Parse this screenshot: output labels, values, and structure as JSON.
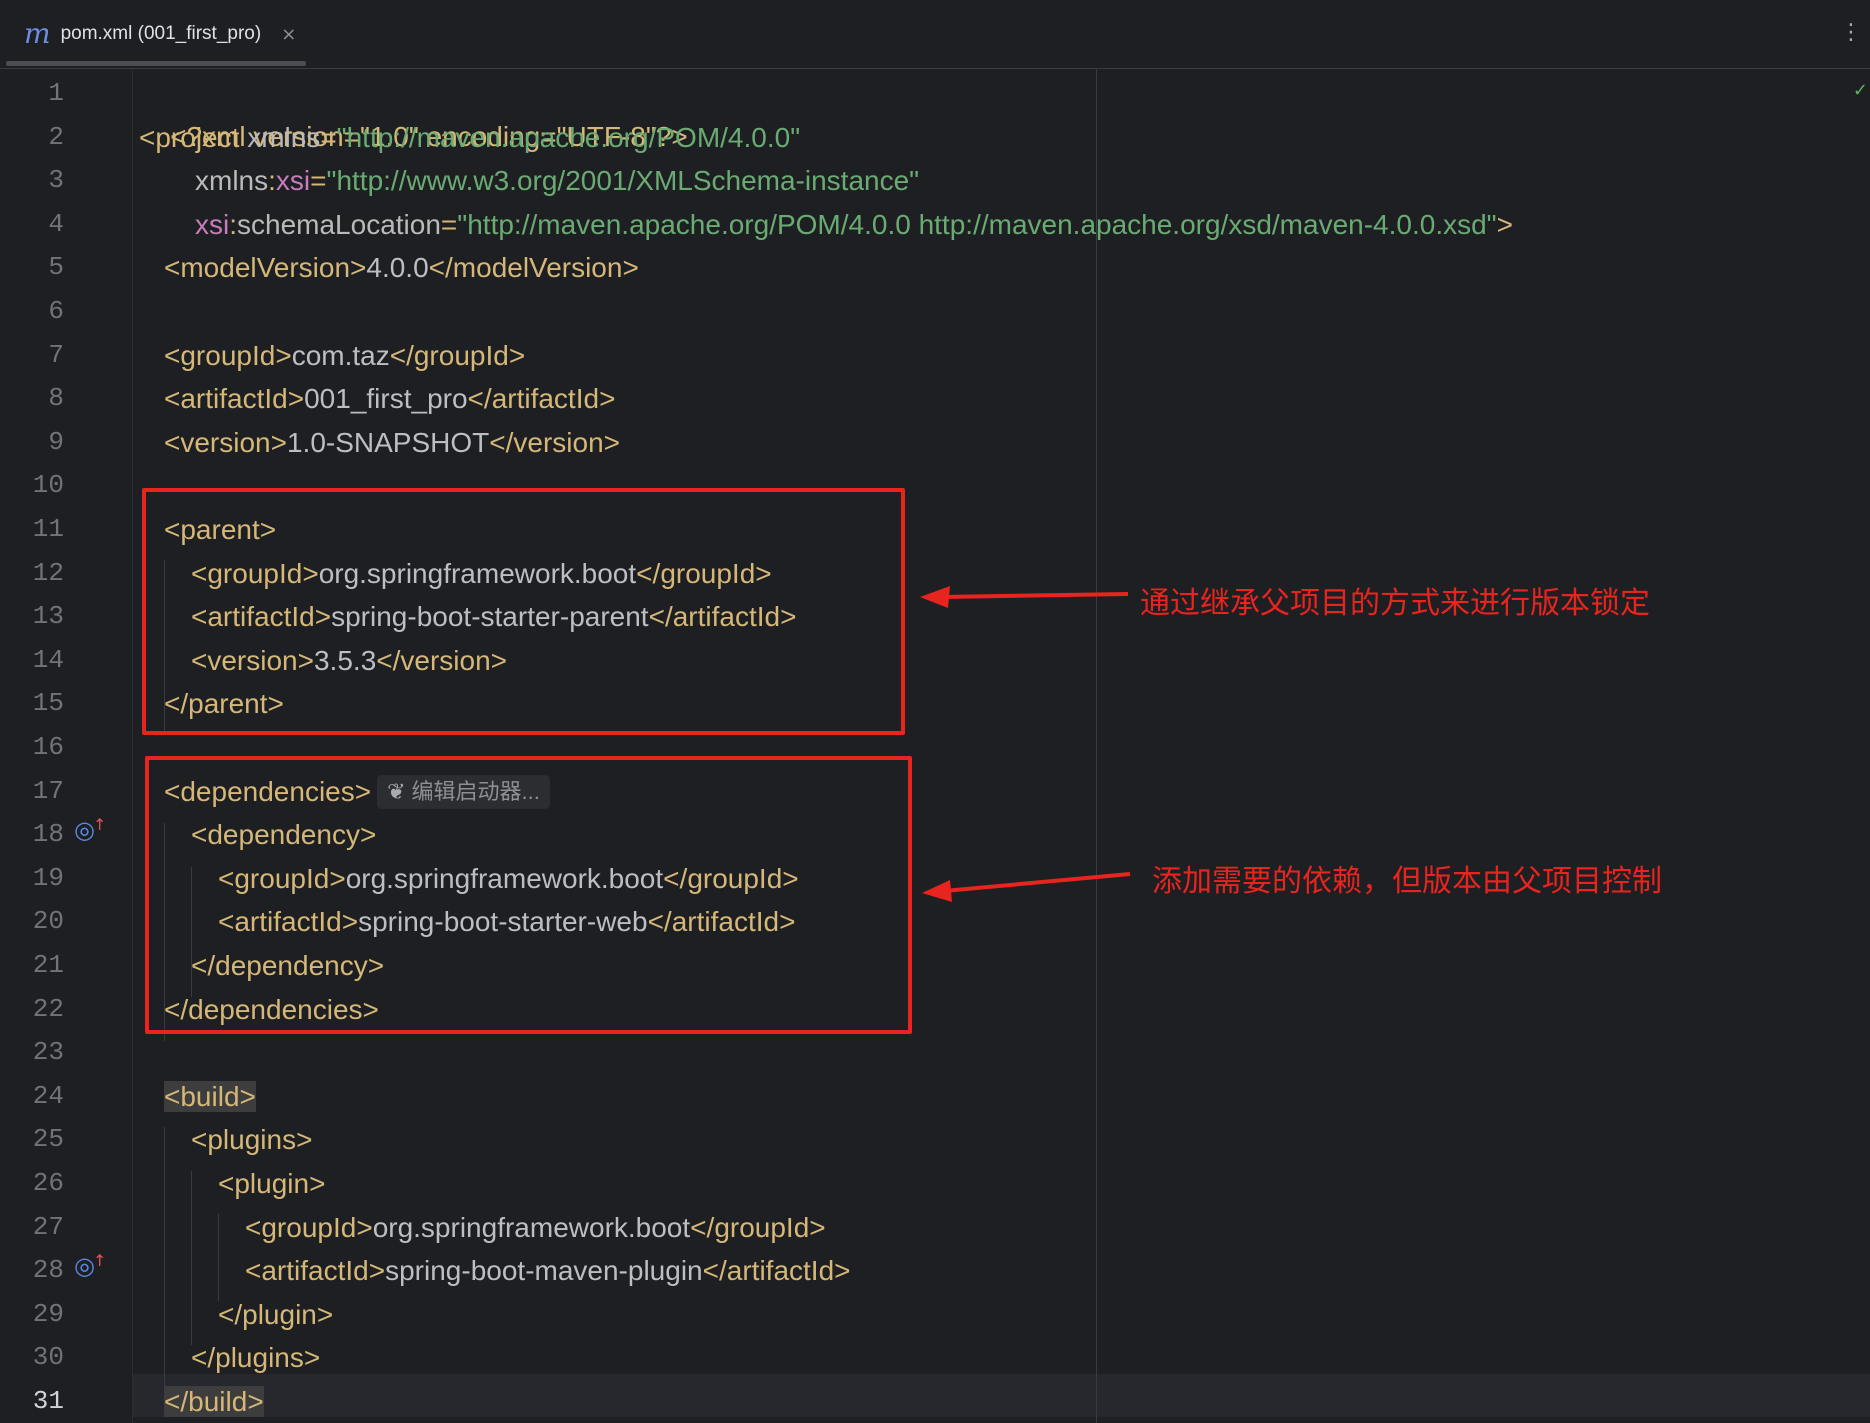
{
  "tab": {
    "label": "pom.xml (001_first_pro)",
    "icon": "m",
    "close": "×"
  },
  "editor": {
    "inlay_hint": "编辑启动器...",
    "annotations": [
      "通过继承父项目的方式来进行版本锁定",
      "添加需要的依赖，但版本由父项目控制"
    ],
    "colors": {
      "annotation": "#e8241f",
      "string": "#6aab73",
      "tag": "#d5b778",
      "namespace": "#c77dbb"
    }
  },
  "lines": [
    {
      "n": "1"
    },
    {
      "n": "2"
    },
    {
      "n": "3"
    },
    {
      "n": "4"
    },
    {
      "n": "5"
    },
    {
      "n": "6"
    },
    {
      "n": "7"
    },
    {
      "n": "8"
    },
    {
      "n": "9"
    },
    {
      "n": "10"
    },
    {
      "n": "11"
    },
    {
      "n": "12"
    },
    {
      "n": "13"
    },
    {
      "n": "14"
    },
    {
      "n": "15"
    },
    {
      "n": "16"
    },
    {
      "n": "17"
    },
    {
      "n": "18"
    },
    {
      "n": "19"
    },
    {
      "n": "20"
    },
    {
      "n": "21"
    },
    {
      "n": "22"
    },
    {
      "n": "23"
    },
    {
      "n": "24"
    },
    {
      "n": "25"
    },
    {
      "n": "26"
    },
    {
      "n": "27"
    },
    {
      "n": "28"
    },
    {
      "n": "29"
    },
    {
      "n": "30"
    },
    {
      "n": "31"
    }
  ],
  "code": {
    "l1": {
      "decl": "<?xml version=\"1.0\" encoding=\"UTF-8\"?>"
    },
    "l2": {
      "tag": "project",
      "attr": "xmlns",
      "val": "\"http://maven.apache.org/POM/4.0.0\""
    },
    "l3": {
      "attr": "xmlns",
      "ns": "xsi",
      "val": "\"http://www.w3.org/2001/XMLSchema-instance\""
    },
    "l4": {
      "ns": "xsi",
      "attr": "schemaLocation",
      "val": "\"http://maven.apache.org/POM/4.0.0 http://maven.apache.org/xsd/maven-4.0.0.xsd\""
    },
    "l5": {
      "tag": "modelVersion",
      "text": "4.0.0"
    },
    "l7": {
      "tag": "groupId",
      "text": "com.taz"
    },
    "l8": {
      "tag": "artifactId",
      "text": "001_first_pro"
    },
    "l9": {
      "tag": "version",
      "text": "1.0-SNAPSHOT"
    },
    "l11": {
      "tag": "parent"
    },
    "l12": {
      "tag": "groupId",
      "text": "org.springframework.boot"
    },
    "l13": {
      "tag": "artifactId",
      "text": "spring-boot-starter-parent"
    },
    "l14": {
      "tag": "version",
      "text": "3.5.3"
    },
    "l17": {
      "tag": "dependencies"
    },
    "l18": {
      "tag": "dependency"
    },
    "l19": {
      "tag": "groupId",
      "text": "org.springframework.boot"
    },
    "l20": {
      "tag": "artifactId",
      "text": "spring-boot-starter-web"
    },
    "l24": {
      "tag": "build"
    },
    "l25": {
      "tag": "plugins"
    },
    "l26": {
      "tag": "plugin"
    },
    "l27": {
      "tag": "groupId",
      "text": "org.springframework.boot"
    },
    "l28": {
      "tag": "artifactId",
      "text": "spring-boot-maven-plugin"
    }
  }
}
